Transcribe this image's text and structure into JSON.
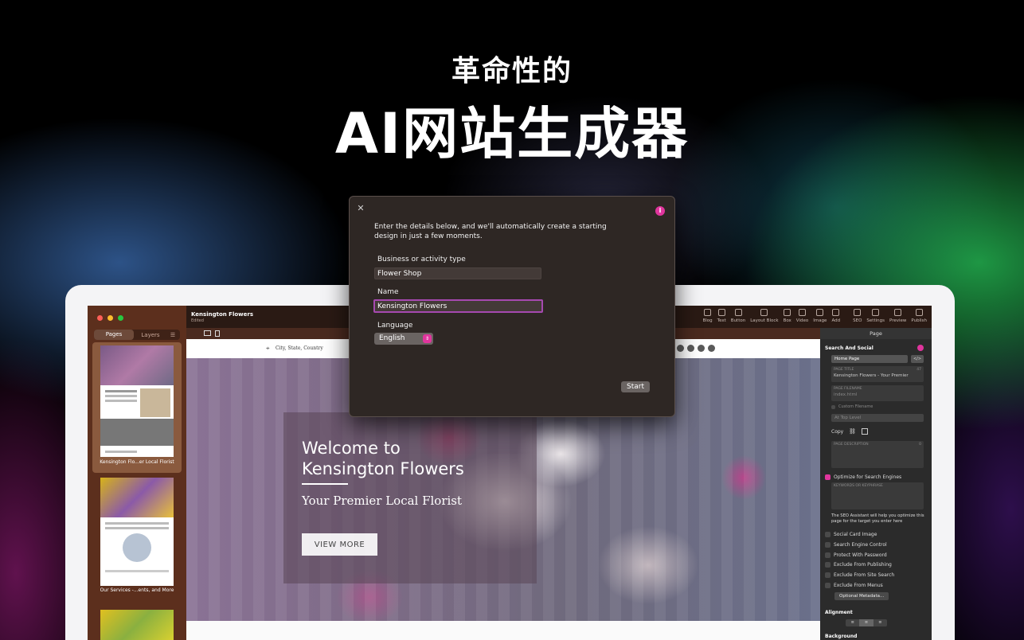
{
  "hero": {
    "subtitle": "革命性的",
    "title": "AI网站生成器"
  },
  "colors": {
    "accent": "#e0359d",
    "dialog_bg": "#2e2724",
    "sidebar_bg": "#5c2f1d"
  },
  "app": {
    "document_title": "Kensington Flowers",
    "document_status": "Edited",
    "sidebar": {
      "tabs": [
        "Pages",
        "Layers"
      ],
      "pages": [
        {
          "label": "Kensington Flo...er Local Florist"
        },
        {
          "label": "Our Services -...ents, and More"
        },
        {
          "label": ""
        }
      ]
    },
    "toolbar": {
      "items": [
        "Blog",
        "Text",
        "Button",
        "Layout Block",
        "Box",
        "Video",
        "Image",
        "Add",
        "SEO",
        "Settings",
        "Preview",
        "Publish"
      ]
    },
    "canvas": {
      "location": "City, State, Country",
      "hero_heading_line1": "Welcome to",
      "hero_heading_line2": "Kensington Flowers",
      "hero_tagline": "Your Premier Local Florist",
      "hero_button": "VIEW MORE"
    },
    "inspector": {
      "header": "Page",
      "section_title": "Search And Social",
      "page_select": "Home Page",
      "page_title_label": "PAGE TITLE",
      "page_title_count": "47",
      "page_title_value": "Kensington Flowers - Your Premier",
      "page_filename_label": "PAGE FILENAME",
      "page_filename_value": "index.html",
      "custom_filename": "Custom Filename",
      "level_select": "At Top Level",
      "copy_label": "Copy",
      "page_description_label": "PAGE DESCRIPTION",
      "page_description_count": "0",
      "optimize_label": "Optimize for Search Engines",
      "keywords_label": "KEYWORDS OR KEYPHRASE",
      "seo_note": "The SEO Assistant will help you optimize this page for the target you enter here",
      "checkboxes": [
        "Social Card Image",
        "Search Engine Control",
        "Protect With Password",
        "Exclude From Publishing",
        "Exclude From Site Search",
        "Exclude From Menus"
      ],
      "metadata_button": "Optional Metadata...",
      "alignment_label": "Alignment",
      "background_label": "Background"
    }
  },
  "dialog": {
    "intro": "Enter the details below, and we'll automatically create a starting design in just a few moments.",
    "business_label": "Business or activity type",
    "business_value": "Flower Shop",
    "name_label": "Name",
    "name_value": "Kensington Flowers",
    "language_label": "Language",
    "language_value": "English",
    "start_button": "Start",
    "info_icon_text": "i",
    "close_icon_text": "✕"
  }
}
